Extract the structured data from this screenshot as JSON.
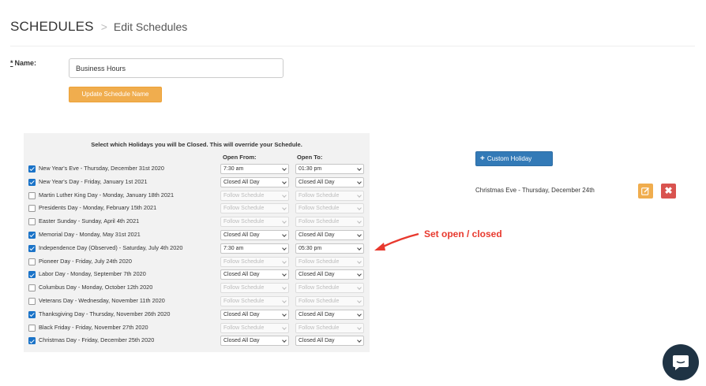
{
  "header": {
    "title": "SCHEDULES",
    "separator": ">",
    "current": "Edit Schedules"
  },
  "form": {
    "name_required_mark": "*",
    "name_label": "Name:",
    "name_value": "Business Hours",
    "update_button": "Update Schedule Name"
  },
  "holidays": {
    "heading": "Select which Holidays you will be Closed. This will override your Schedule.",
    "col_from": "Open From:",
    "col_to": "Open To:",
    "rows": [
      {
        "label": "New Year's Eve - Thursday, December 31st 2020",
        "checked": true,
        "from": "7:30 am",
        "to": "01:30 pm"
      },
      {
        "label": "New Year's Day - Friday, January 1st 2021",
        "checked": true,
        "from": "Closed All Day",
        "to": "Closed All Day"
      },
      {
        "label": "Martin Luther King Day - Monday, January 18th 2021",
        "checked": false,
        "from": "Follow Schedule",
        "to": "Follow Schedule"
      },
      {
        "label": "Presidents Day - Monday, February 15th 2021",
        "checked": false,
        "from": "Follow Schedule",
        "to": "Follow Schedule"
      },
      {
        "label": "Easter Sunday - Sunday, April 4th 2021",
        "checked": false,
        "from": "Follow Schedule",
        "to": "Follow Schedule"
      },
      {
        "label": "Memorial Day - Monday, May 31st 2021",
        "checked": true,
        "from": "Closed All Day",
        "to": "Closed All Day"
      },
      {
        "label": "Independence Day (Observed) - Saturday, July 4th 2020",
        "checked": true,
        "from": "7:30 am",
        "to": "05:30 pm"
      },
      {
        "label": "Pioneer Day - Friday, July 24th 2020",
        "checked": false,
        "from": "Follow Schedule",
        "to": "Follow Schedule"
      },
      {
        "label": "Labor Day - Monday, September 7th 2020",
        "checked": true,
        "from": "Closed All Day",
        "to": "Closed All Day"
      },
      {
        "label": "Columbus Day - Monday, October 12th 2020",
        "checked": false,
        "from": "Follow Schedule",
        "to": "Follow Schedule"
      },
      {
        "label": "Veterans Day - Wednesday, November 11th 2020",
        "checked": false,
        "from": "Follow Schedule",
        "to": "Follow Schedule"
      },
      {
        "label": "Thanksgiving Day - Thursday, November 26th 2020",
        "checked": true,
        "from": "Closed All Day",
        "to": "Closed All Day"
      },
      {
        "label": "Black Friday - Friday, November 27th 2020",
        "checked": false,
        "from": "Follow Schedule",
        "to": "Follow Schedule"
      },
      {
        "label": "Christmas Day - Friday, December 25th 2020",
        "checked": true,
        "from": "Closed All Day",
        "to": "Closed All Day"
      }
    ]
  },
  "custom": {
    "button_plus": "+",
    "button_label": "Custom Holiday",
    "item_label": "Christmas Eve - Thursday, December 24th",
    "edit_icon": "edit-icon",
    "delete_icon": "close-icon",
    "delete_glyph": "✖"
  },
  "annotation": {
    "text": "Set open / closed"
  },
  "colors": {
    "accent_orange": "#f0ad4e",
    "primary_blue": "#337ab7",
    "danger_red": "#d9534f",
    "annotation_red": "#e8392e",
    "checkbox_blue": "#1a73c8",
    "chat_bg": "#1f3344"
  }
}
